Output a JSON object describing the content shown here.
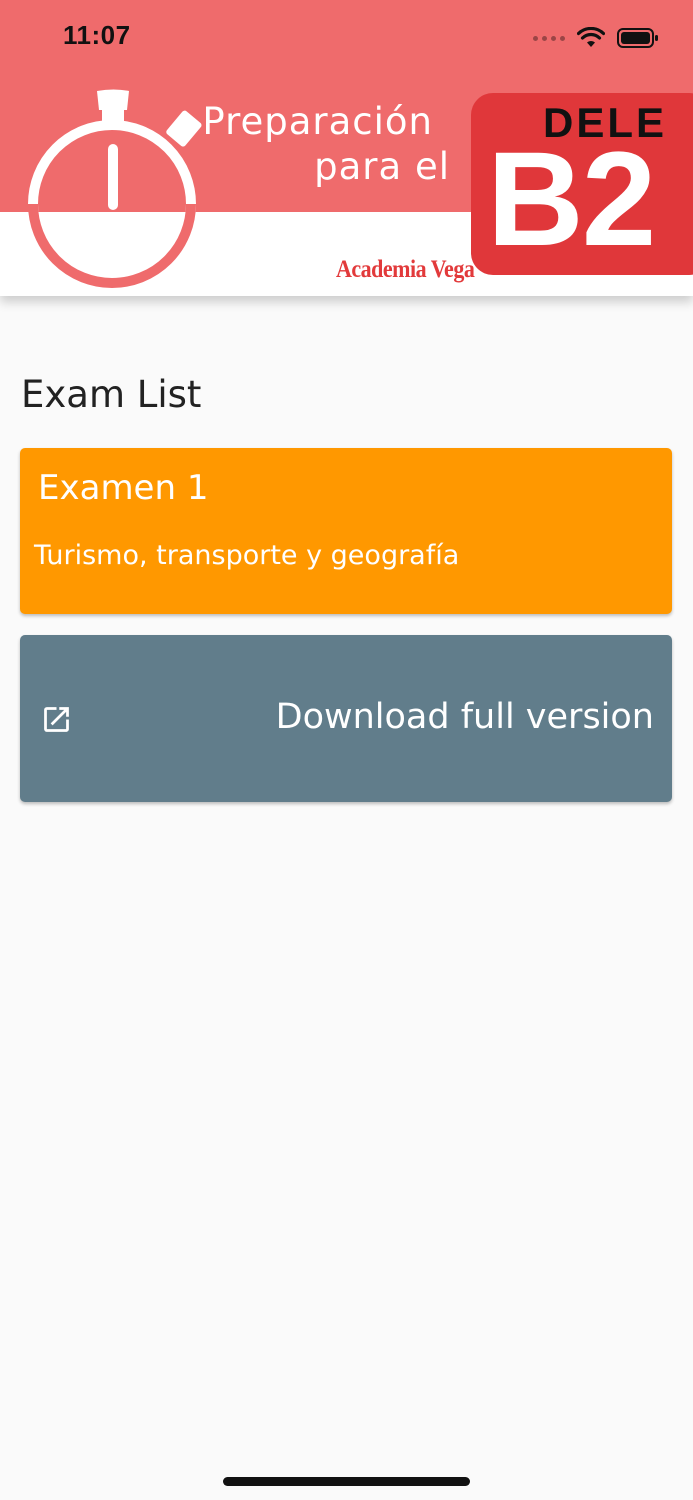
{
  "status_bar": {
    "time": "11:07",
    "icons": [
      "signal-icon",
      "wifi-icon",
      "battery-icon"
    ]
  },
  "header": {
    "line1": "Preparación",
    "line2": "para el",
    "badge_top": "DELE",
    "badge_main": "B2",
    "brand": "Academia Vega",
    "icon": "stopwatch-icon",
    "colors": {
      "banner": "#ef6b6c",
      "badge": "#e0373a",
      "brand": "#e23a3b"
    }
  },
  "main": {
    "section_title": "Exam List",
    "exams": [
      {
        "title": "Examen 1",
        "subtitle": "Turismo, transporte y geografía",
        "color": "#ff9800"
      }
    ],
    "download": {
      "label": "Download full version",
      "icon": "open-in-new-icon",
      "color": "#617d8b"
    }
  }
}
